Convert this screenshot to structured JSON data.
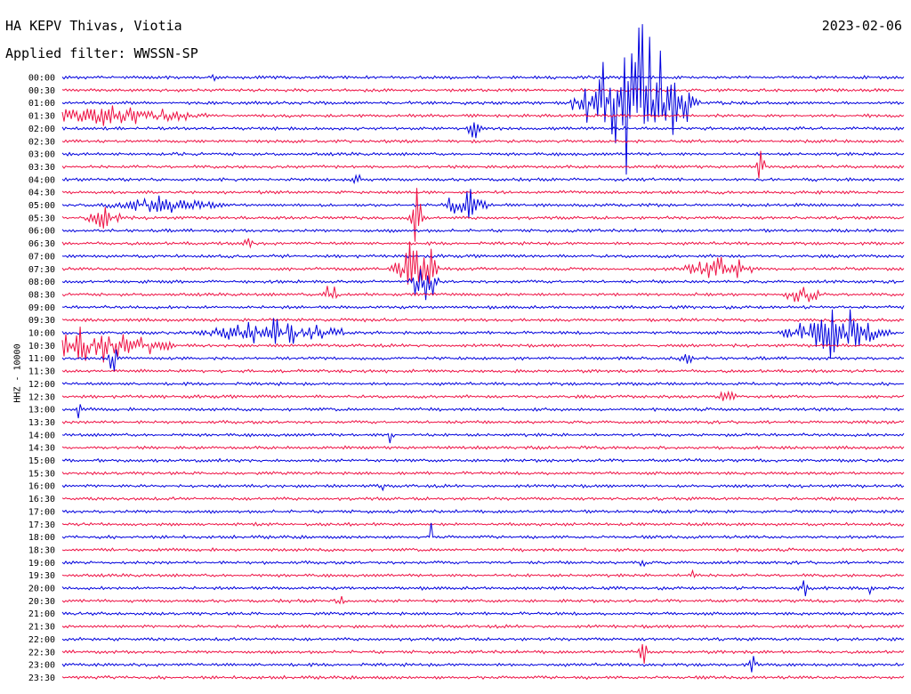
{
  "header": {
    "station": "HA KEPV Thivas, Viotia",
    "filter": "Applied filter: WWSSN-SP",
    "date": "2023-02-06"
  },
  "chart_data": {
    "type": "line",
    "title": "HA KEPV Thivas, Viotia",
    "subtitle": "Applied filter: WWSSN-SP",
    "ylabel": "HHZ - 10000",
    "tick_labels": [
      "00:00",
      "00:30",
      "01:00",
      "01:30",
      "02:00",
      "02:30",
      "03:00",
      "03:30",
      "04:00",
      "04:30",
      "05:00",
      "05:30",
      "06:00",
      "06:30",
      "07:00",
      "07:30",
      "08:00",
      "08:30",
      "09:00",
      "09:30",
      "10:00",
      "10:30",
      "11:00",
      "11:30",
      "12:00",
      "12:30",
      "13:00",
      "13:30",
      "14:00",
      "14:30",
      "15:00",
      "15:30",
      "16:00",
      "16:30",
      "17:00",
      "17:30",
      "18:00",
      "18:30",
      "19:00",
      "19:30",
      "20:00",
      "20:30",
      "21:00",
      "21:30",
      "22:00",
      "22:30",
      "23:00",
      "23:30"
    ],
    "series_colors": [
      "#0000dd",
      "#ee1144"
    ],
    "events": [
      {
        "row": 0,
        "x": 0.18,
        "amp": 8,
        "w": 0.004
      },
      {
        "row": 2,
        "x": 0.68,
        "amp": 70,
        "w": 0.08
      },
      {
        "row": 3,
        "x": 0.04,
        "amp": 10,
        "w": 0.15
      },
      {
        "row": 4,
        "x": 0.49,
        "amp": 25,
        "w": 0.01
      },
      {
        "row": 7,
        "x": 0.83,
        "amp": 18,
        "w": 0.006
      },
      {
        "row": 8,
        "x": 0.35,
        "amp": 10,
        "w": 0.006
      },
      {
        "row": 10,
        "x": 0.48,
        "amp": 22,
        "w": 0.03
      },
      {
        "row": 10,
        "x": 0.12,
        "amp": 8,
        "w": 0.08
      },
      {
        "row": 11,
        "x": 0.05,
        "amp": 10,
        "w": 0.03
      },
      {
        "row": 11,
        "x": 0.42,
        "amp": 40,
        "w": 0.01
      },
      {
        "row": 13,
        "x": 0.22,
        "amp": 12,
        "w": 0.006
      },
      {
        "row": 15,
        "x": 0.42,
        "amp": 40,
        "w": 0.03
      },
      {
        "row": 15,
        "x": 0.78,
        "amp": 14,
        "w": 0.05
      },
      {
        "row": 16,
        "x": 0.43,
        "amp": 22,
        "w": 0.02
      },
      {
        "row": 17,
        "x": 0.32,
        "amp": 16,
        "w": 0.01
      },
      {
        "row": 17,
        "x": 0.88,
        "amp": 10,
        "w": 0.03
      },
      {
        "row": 20,
        "x": 0.25,
        "amp": 14,
        "w": 0.1
      },
      {
        "row": 20,
        "x": 0.92,
        "amp": 30,
        "w": 0.07
      },
      {
        "row": 21,
        "x": 0.04,
        "amp": 20,
        "w": 0.1
      },
      {
        "row": 22,
        "x": 0.06,
        "amp": 12,
        "w": 0.01
      },
      {
        "row": 22,
        "x": 0.74,
        "amp": 12,
        "w": 0.01
      },
      {
        "row": 25,
        "x": 0.79,
        "amp": 8,
        "w": 0.015
      },
      {
        "row": 26,
        "x": 0.02,
        "amp": 10,
        "w": 0.004
      },
      {
        "row": 28,
        "x": 0.39,
        "amp": 12,
        "w": 0.004
      },
      {
        "row": 32,
        "x": 0.38,
        "amp": 12,
        "w": 0.004
      },
      {
        "row": 36,
        "x": 0.44,
        "amp": 20,
        "w": 0.004
      },
      {
        "row": 38,
        "x": 0.69,
        "amp": 12,
        "w": 0.004
      },
      {
        "row": 39,
        "x": 0.75,
        "amp": 14,
        "w": 0.006
      },
      {
        "row": 40,
        "x": 0.88,
        "amp": 12,
        "w": 0.01
      },
      {
        "row": 40,
        "x": 0.96,
        "amp": 10,
        "w": 0.008
      },
      {
        "row": 41,
        "x": 0.33,
        "amp": 10,
        "w": 0.006
      },
      {
        "row": 45,
        "x": 0.69,
        "amp": 14,
        "w": 0.006
      },
      {
        "row": 46,
        "x": 0.82,
        "amp": 12,
        "w": 0.006
      }
    ]
  }
}
